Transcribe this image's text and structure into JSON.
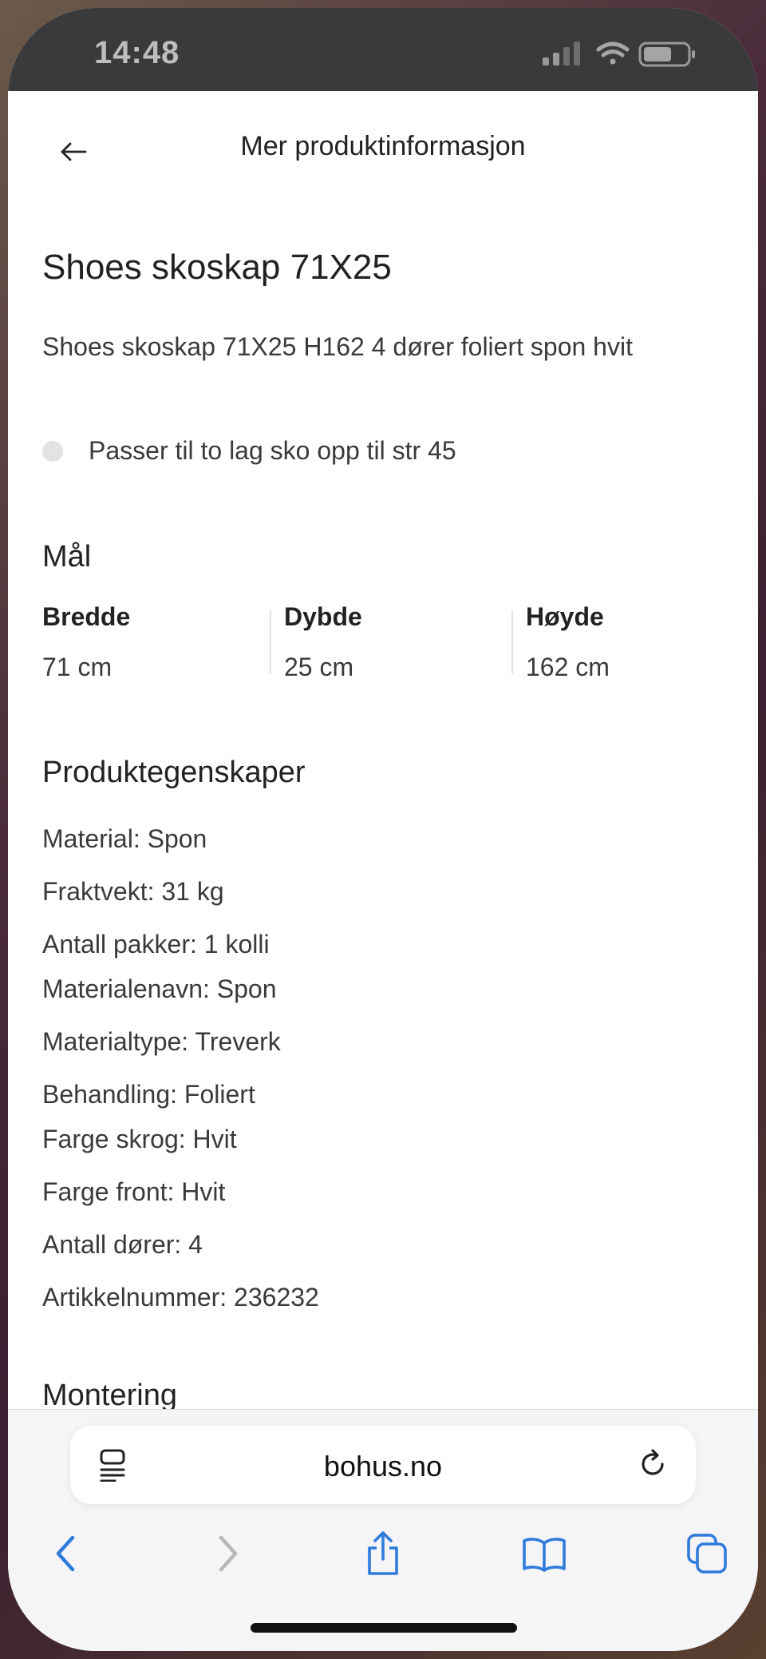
{
  "status": {
    "time": "14:48"
  },
  "header": {
    "title": "Mer produktinformasjon"
  },
  "product": {
    "name": "Shoes skoskap 71X25",
    "description": "Shoes skoskap 71X25 H162 4 dører foliert spon hvit",
    "bullet": "Passer til to lag sko opp til str 45"
  },
  "dimensions": {
    "heading": "Mål",
    "items": [
      {
        "label": "Bredde",
        "value": "71 cm"
      },
      {
        "label": "Dybde",
        "value": "25 cm"
      },
      {
        "label": "Høyde",
        "value": "162 cm"
      }
    ]
  },
  "properties": {
    "heading": "Produktegenskaper",
    "items": [
      "Material: Spon",
      "Fraktvekt: 31 kg",
      "Antall pakker: 1 kolli",
      "Materialenavn: Spon",
      "Materialtype: Treverk",
      "Behandling: Foliert",
      "Farge skrog: Hvit",
      "Farge front: Hvit",
      "Antall dører: 4",
      "Artikkelnummer: 236232"
    ]
  },
  "next_section": {
    "heading": "Montering"
  },
  "browser": {
    "url": "bohus.no",
    "accent": "#2f7bdc"
  }
}
